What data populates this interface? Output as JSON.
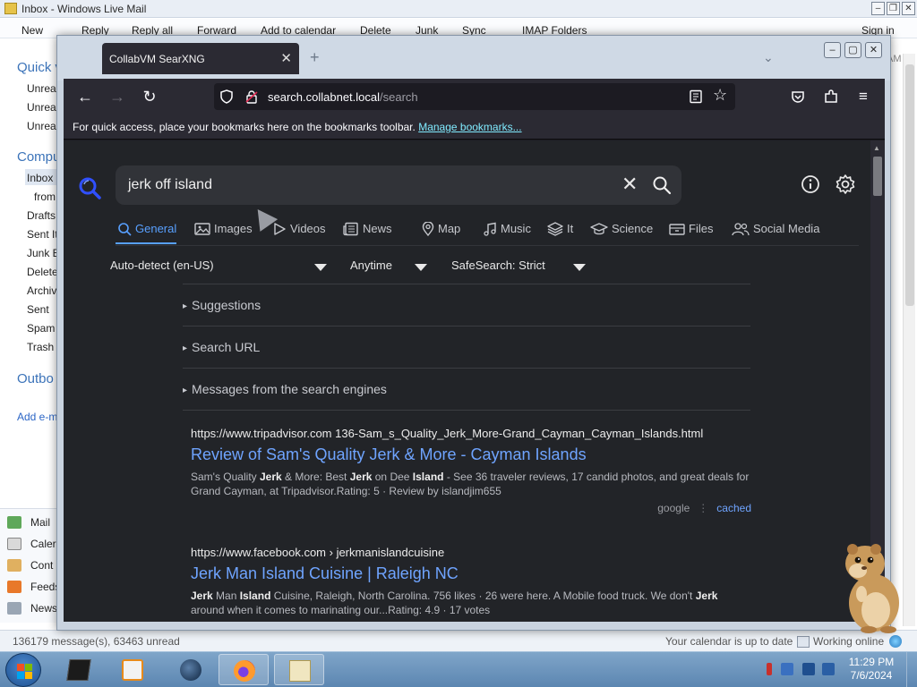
{
  "wlm": {
    "title": "Inbox - Windows Live Mail",
    "toolbar": [
      "New",
      "Reply",
      "Reply all",
      "Forward",
      "Add to calendar",
      "Delete",
      "Junk",
      "Sync",
      "IMAP Folders"
    ],
    "signin": "Sign in",
    "sidebar": {
      "quick_views": "Quick v",
      "unread": [
        "Unrea",
        "Unrea",
        "Unrea"
      ],
      "account": "Compu",
      "folders": [
        "Inbox",
        "from",
        "Drafts",
        "Sent It",
        "Junk E",
        "Delete",
        "Archiv",
        "Sent",
        "Spam",
        "Trash"
      ],
      "outbox": "Outbo",
      "add_email": "Add e-m"
    },
    "nav": [
      "Mail",
      "Caler",
      "Cont",
      "Feeds",
      "News"
    ],
    "am": "AM",
    "status_left": "136179 message(s), 63463 unread",
    "status_calendar": "Your calendar is up to date",
    "status_online": "Working online"
  },
  "firefox": {
    "tab_title": "CollabVM SearXNG",
    "url_host": "search.collabnet.local",
    "url_path": "/search",
    "bookmarks_text": "For quick access, place your bookmarks here on the bookmarks toolbar.",
    "bookmarks_link": "Manage bookmarks..."
  },
  "search": {
    "query": "jerk off island",
    "categories": [
      "General",
      "Images",
      "Videos",
      "News",
      "Map",
      "Music",
      "It",
      "Science",
      "Files",
      "Social Media"
    ],
    "active_category": "General",
    "filters": {
      "language": "Auto-detect (en-US)",
      "time": "Anytime",
      "safesearch": "SafeSearch: Strict"
    },
    "accordions": [
      "Suggestions",
      "Search URL",
      "Messages from the search engines"
    ],
    "results": [
      {
        "url": "https://www.tripadvisor.com  136-Sam_s_Quality_Jerk_More-Grand_Cayman_Cayman_Islands.html",
        "title": "Review of Sam's Quality Jerk & More - Cayman Islands",
        "desc_parts": [
          "Sam's Quality ",
          "Jerk",
          " & More: Best ",
          "Jerk",
          " on Dee ",
          "Island",
          " - See 36 traveler reviews, 17 candid photos, and great deals for Grand Cayman, at Tripadvisor.Rating: 5 · Review by islandjim655"
        ],
        "engine": "google",
        "cached": "cached"
      },
      {
        "url": "https://www.facebook.com  › jerkmanislandcuisine",
        "title": "Jerk Man Island Cuisine | Raleigh NC",
        "desc_parts": [
          "Jerk",
          " Man ",
          "Island",
          " Cuisine, Raleigh, North Carolina. 756 likes · 26 were here. A Mobile food truck. We don't ",
          "Jerk",
          " around when it comes to marinating our...Rating: 4.9 · 17 votes"
        ]
      }
    ]
  },
  "taskbar": {
    "time": "11:29 PM",
    "date": "7/6/2024"
  },
  "colors": {
    "accent": "#58a0ff",
    "link": "#6fa4ff",
    "page_bg": "#222428"
  }
}
